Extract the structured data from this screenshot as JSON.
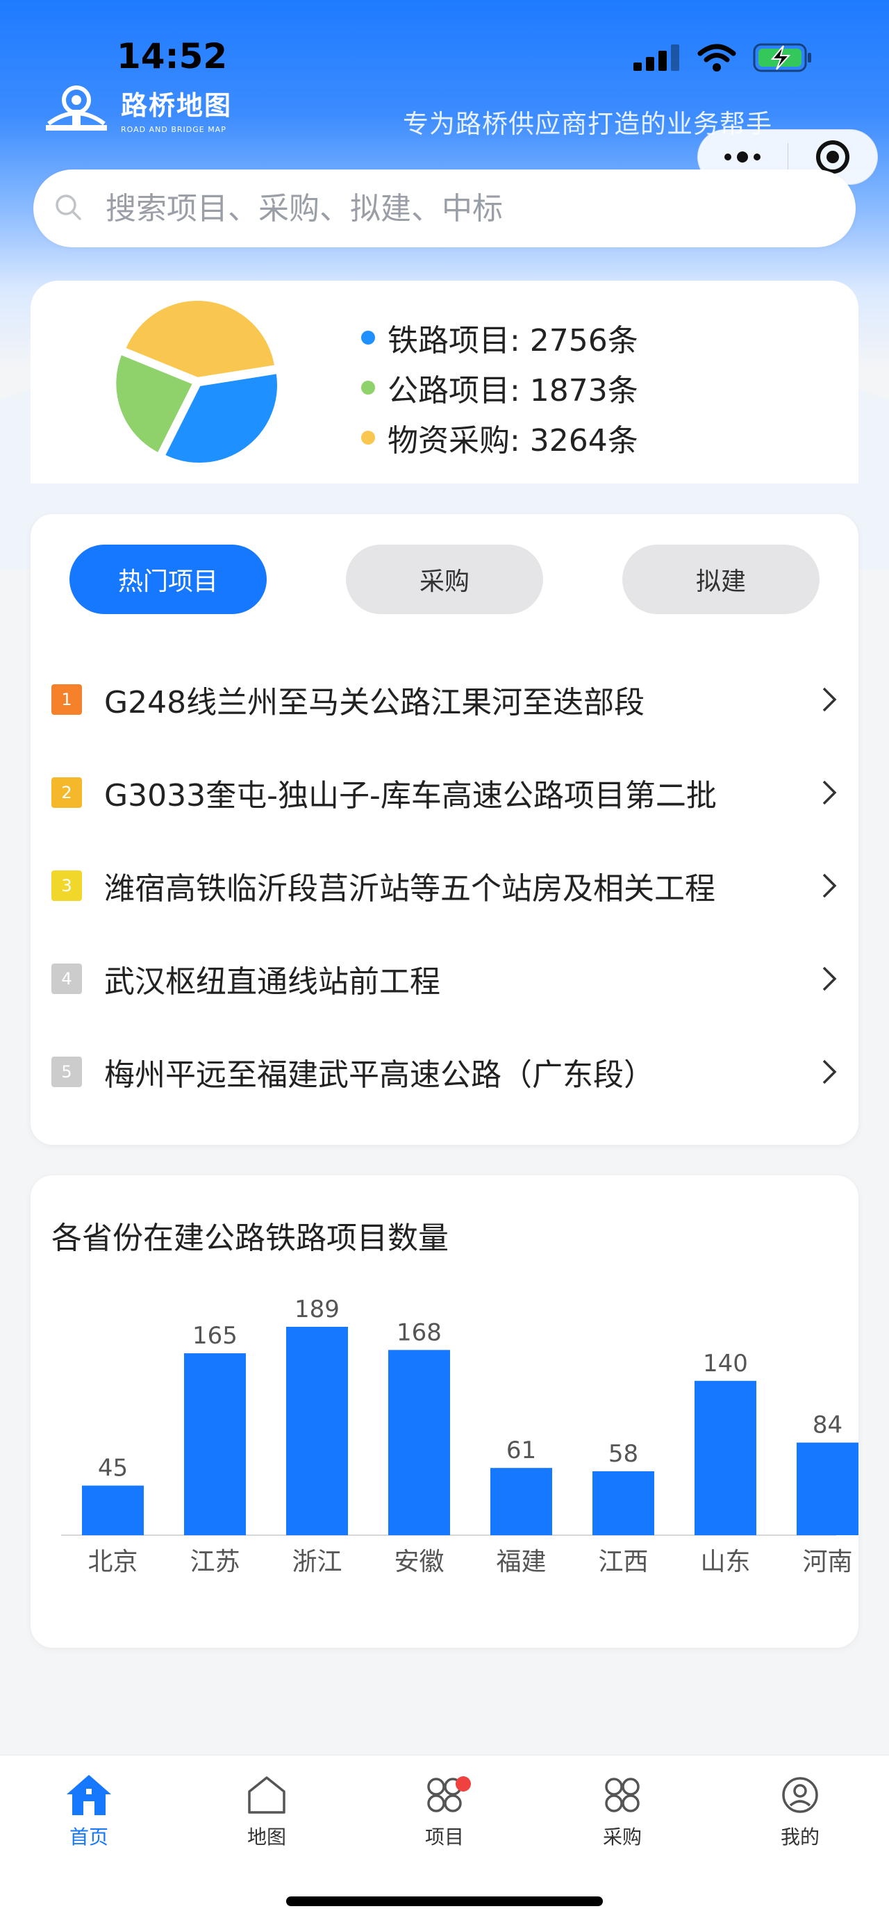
{
  "status_bar": {
    "time": "14:52"
  },
  "header": {
    "logo_cn": "路桥地图",
    "logo_en": "ROAD AND BRIDGE MAP",
    "slogan": "专为路桥供应商打造的业务帮手"
  },
  "search": {
    "placeholder": "搜索项目、采购、拟建、中标"
  },
  "stats": {
    "items": [
      {
        "label": "铁路项目: 2756条",
        "value": 2756,
        "color": "#1e90ff"
      },
      {
        "label": "公路项目: 1873条",
        "value": 1873,
        "color": "#8fd16a"
      },
      {
        "label": "物资采购: 3264条",
        "value": 3264,
        "color": "#f9c74f"
      }
    ]
  },
  "hot": {
    "tabs": [
      {
        "label": "热门项目",
        "active": true
      },
      {
        "label": "采购",
        "active": false
      },
      {
        "label": "拟建",
        "active": false
      }
    ],
    "items": [
      {
        "rank": "1",
        "rank_color": "#f5812b",
        "title": "G248线兰州至马关公路江果河至迭部段"
      },
      {
        "rank": "2",
        "rank_color": "#f5b82b",
        "title": "G3033奎屯-独山子-库车高速公路项目第二批"
      },
      {
        "rank": "3",
        "rank_color": "#f2d72b",
        "title": "潍宿高铁临沂段莒沂站等五个站房及相关工程"
      },
      {
        "rank": "4",
        "rank_color": "#cccccc",
        "title": "武汉枢纽直通线站前工程"
      },
      {
        "rank": "5",
        "rank_color": "#cccccc",
        "title": "梅州平远至福建武平高速公路（广东段）"
      }
    ]
  },
  "chart_data": {
    "type": "bar",
    "title": "各省份在建公路铁路项目数量",
    "categories": [
      "北京",
      "江苏",
      "浙江",
      "安徽",
      "福建",
      "江西",
      "山东",
      "河南"
    ],
    "values": [
      45,
      165,
      189,
      168,
      61,
      58,
      140,
      84
    ],
    "color": "#1677ff",
    "xlabel": "",
    "ylabel": "",
    "ylim": [
      0,
      189
    ],
    "grid": false
  },
  "tabbar": {
    "items": [
      {
        "label": "首页",
        "icon": "home-icon",
        "active": true
      },
      {
        "label": "地图",
        "icon": "map-icon",
        "active": false
      },
      {
        "label": "项目",
        "icon": "project-icon",
        "active": false,
        "badge": true
      },
      {
        "label": "采购",
        "icon": "purchase-icon",
        "active": false
      },
      {
        "label": "我的",
        "icon": "profile-icon",
        "active": false
      }
    ]
  }
}
